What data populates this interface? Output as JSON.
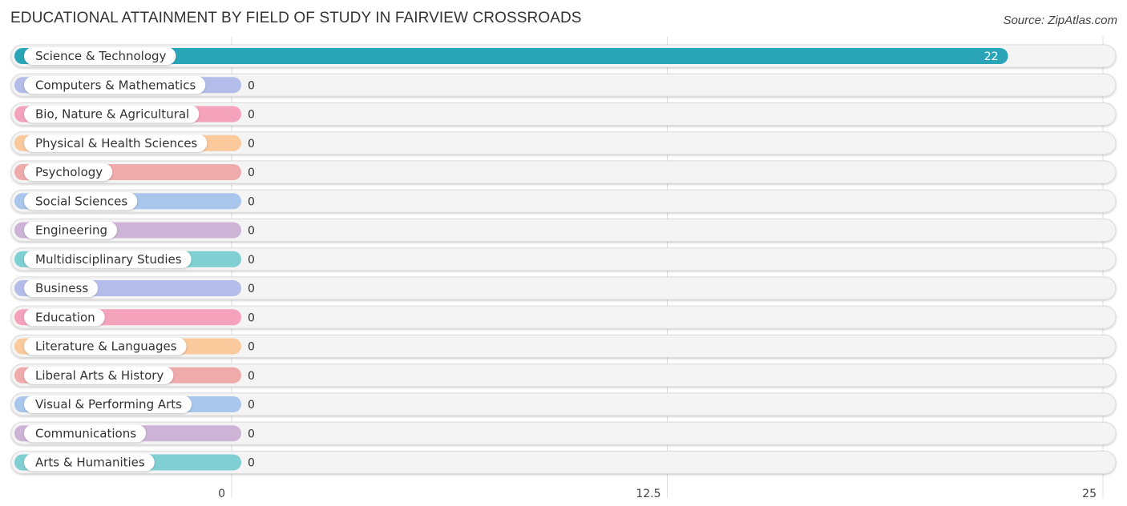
{
  "header": {
    "title": "EDUCATIONAL ATTAINMENT BY FIELD OF STUDY IN FAIRVIEW CROSSROADS",
    "source": "Source: ZipAtlas.com"
  },
  "chart_data": {
    "type": "bar",
    "orientation": "horizontal",
    "title": "EDUCATIONAL ATTAINMENT BY FIELD OF STUDY IN FAIRVIEW CROSSROADS",
    "xlabel": "",
    "ylabel": "",
    "xlim": [
      0,
      25
    ],
    "xticks": [
      0,
      12.5,
      25
    ],
    "xtick_labels": [
      "0",
      "12.5",
      "25"
    ],
    "grid": true,
    "categories": [
      "Science & Technology",
      "Computers & Mathematics",
      "Bio, Nature & Agricultural",
      "Physical & Health Sciences",
      "Psychology",
      "Social Sciences",
      "Engineering",
      "Multidisciplinary Studies",
      "Business",
      "Education",
      "Literature & Languages",
      "Liberal Arts & History",
      "Visual & Performing Arts",
      "Communications",
      "Arts & Humanities"
    ],
    "values": [
      22,
      0,
      0,
      0,
      0,
      0,
      0,
      0,
      0,
      0,
      0,
      0,
      0,
      0,
      0
    ],
    "value_labels": [
      "22",
      "0",
      "0",
      "0",
      "0",
      "0",
      "0",
      "0",
      "0",
      "0",
      "0",
      "0",
      "0",
      "0",
      "0"
    ],
    "colors": [
      "#2aa5b8",
      "#b4bdea",
      "#f5a3bd",
      "#fac99c",
      "#efabab",
      "#a9c6ec",
      "#cdb4d6",
      "#7fcfd3",
      "#b4bdea",
      "#f5a3bd",
      "#fac99c",
      "#efabab",
      "#a9c6ec",
      "#cdb4d6",
      "#7fcfd3"
    ]
  }
}
